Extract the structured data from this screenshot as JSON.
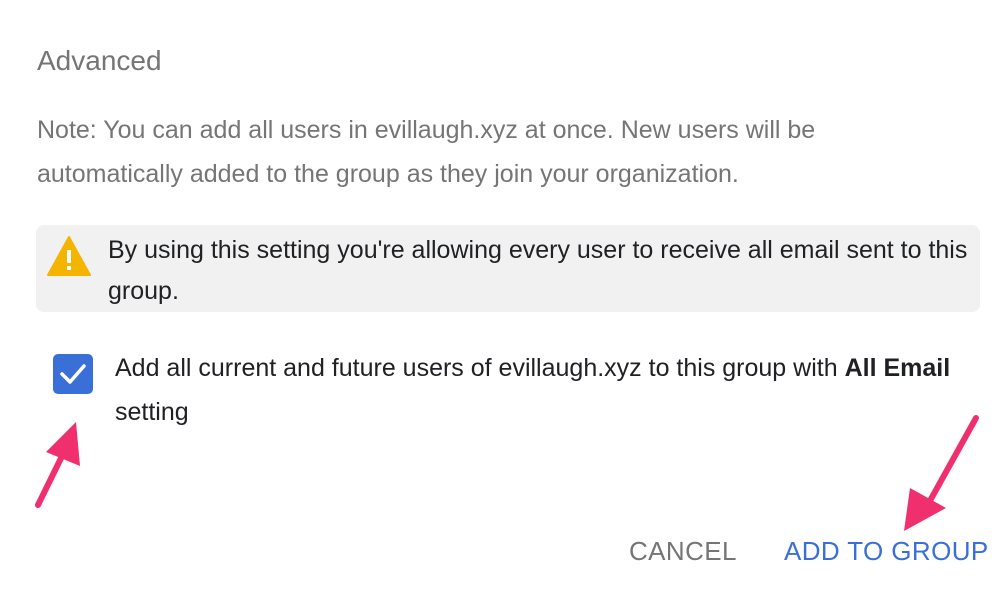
{
  "section": {
    "title": "Advanced",
    "note": "Note: You can add all users in evillaugh.xyz at once. New users will be automatically added to the group as they join your organization."
  },
  "warning": {
    "icon": "warning-triangle-icon",
    "text": "By using this setting you're allowing every user to receive all email sent to this group.",
    "icon_color": "#f4b400",
    "background": "#f1f1f1"
  },
  "option": {
    "checked": true,
    "label_prefix": "Add all current and future users of evillaugh.xyz to this group with ",
    "label_bold": "All Email",
    "label_suffix": " setting",
    "checkbox_color": "#3b6fd8"
  },
  "actions": {
    "cancel_label": "CANCEL",
    "add_label": "ADD TO GROUP",
    "accent_color": "#3b6fd8"
  },
  "annotations": {
    "arrow_color": "#f0306e"
  }
}
